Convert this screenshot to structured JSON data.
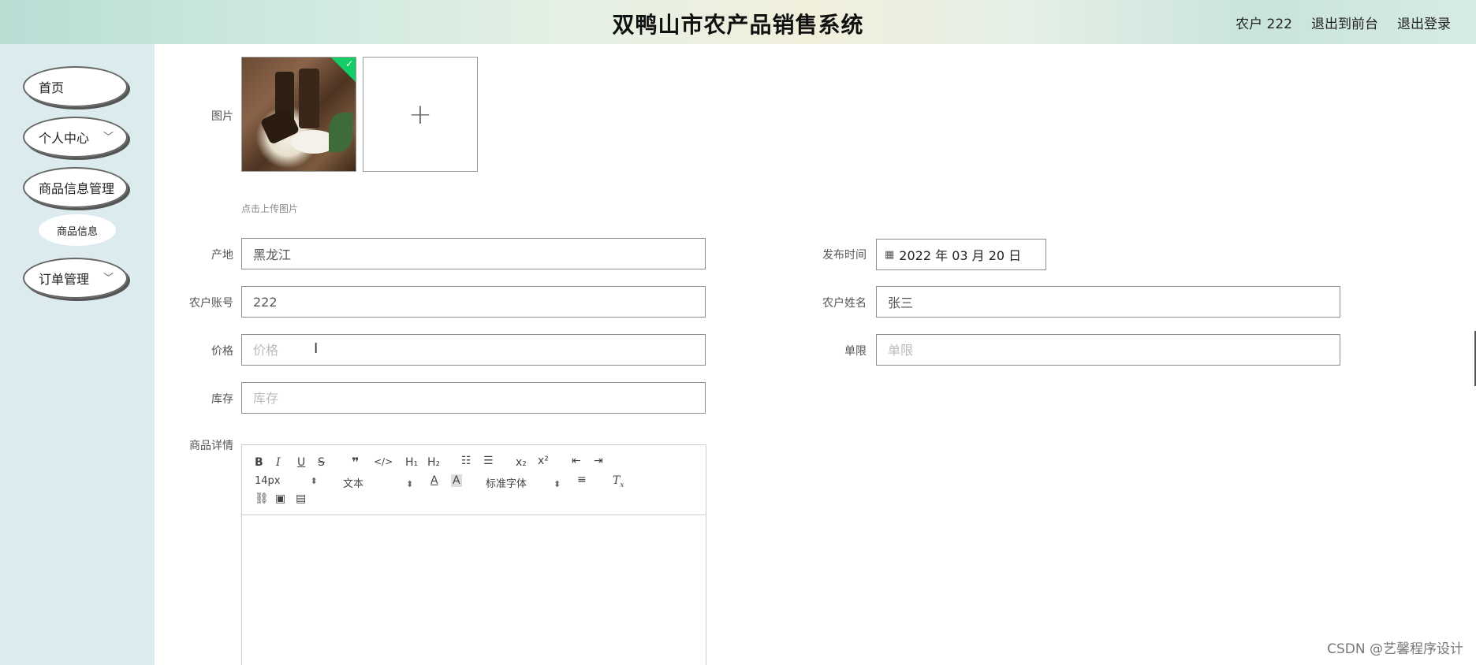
{
  "header": {
    "title": "双鸭山市农产品销售系统",
    "user": "农户 222",
    "back_front": "退出到前台",
    "logout": "退出登录"
  },
  "sidebar": {
    "items": [
      {
        "label": "首页"
      },
      {
        "label": "个人中心",
        "chevron": "chevron-down-icon"
      },
      {
        "label": "商品信息管理"
      },
      {
        "label": "商品信息"
      },
      {
        "label": "订单管理",
        "chevron": "chevron-down-icon"
      }
    ]
  },
  "form": {
    "image_label": "图片",
    "upload_hint": "点击上传图片",
    "origin_label": "产地",
    "origin_value": "黑龙江",
    "publish_label": "发布时间",
    "publish_value": "2022 年 03 月 20 日",
    "account_label": "农户账号",
    "account_value": "222",
    "farmer_name_label": "农户姓名",
    "farmer_name_value": "张三",
    "price_label": "价格",
    "price_placeholder": "价格",
    "limit_label": "单限",
    "limit_placeholder": "单限",
    "stock_label": "库存",
    "stock_placeholder": "库存",
    "detail_label": "商品详情"
  },
  "editor": {
    "font_size": "14px",
    "text_style": "文本",
    "font_family": "标准字体"
  },
  "watermark": "CSDN @艺馨程序设计",
  "colors": {
    "upload_success": "#13ce66",
    "sidebar_bg": "#dcebee"
  }
}
